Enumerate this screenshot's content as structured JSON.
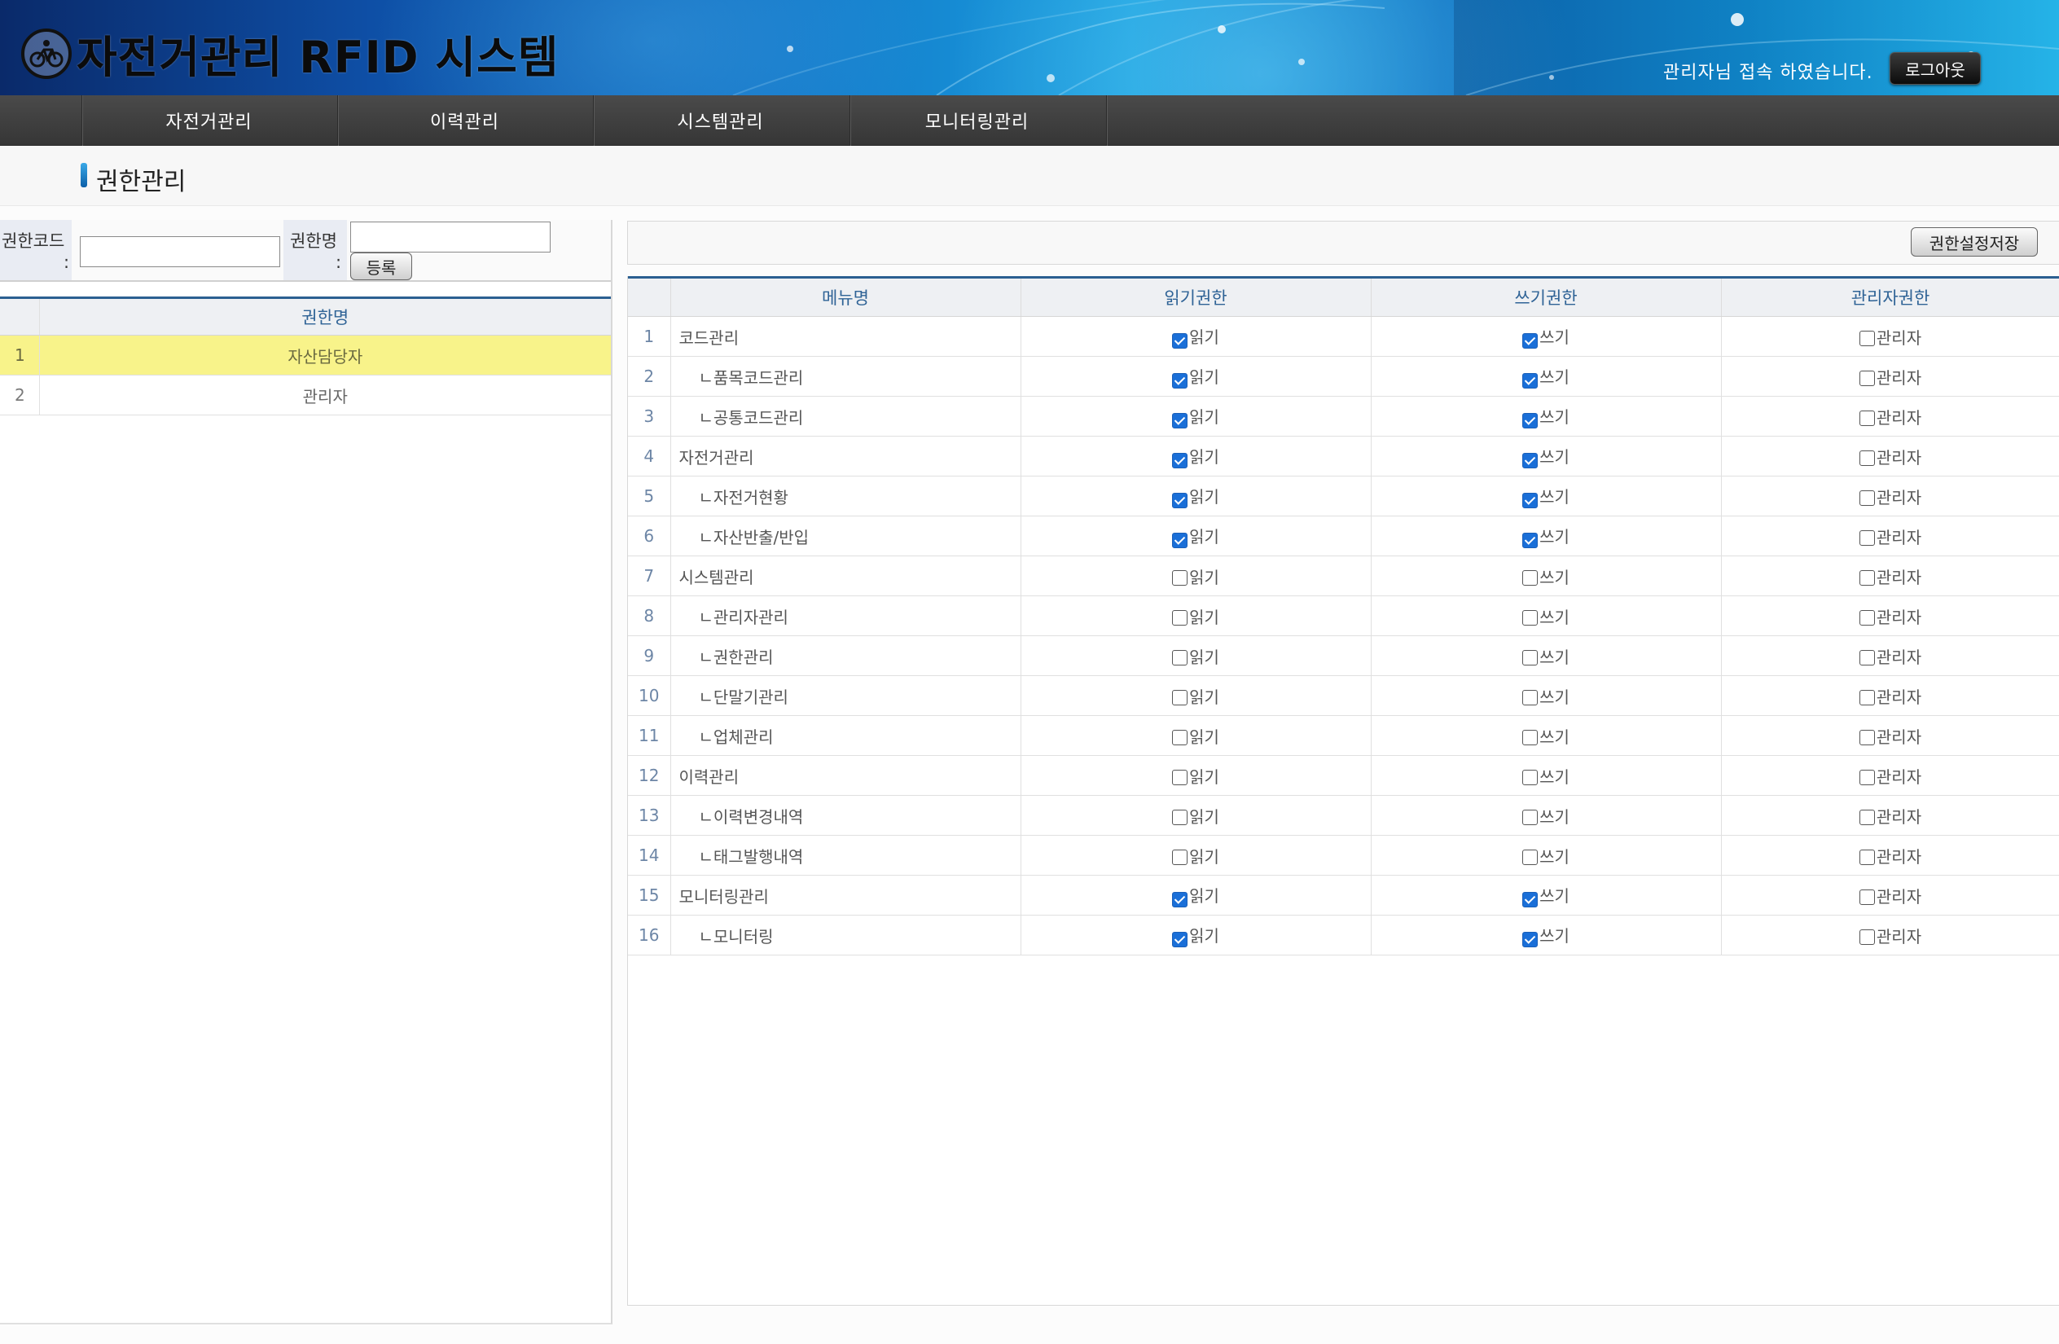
{
  "header": {
    "title": "자전거관리 RFID 시스템",
    "login_message": "관리자님 접속 하였습니다.",
    "logout_label": "로그아웃"
  },
  "nav": [
    {
      "label": "자전거관리"
    },
    {
      "label": "이력관리"
    },
    {
      "label": "시스템관리"
    },
    {
      "label": "모니터링관리"
    }
  ],
  "page": {
    "title": "권한관리"
  },
  "form": {
    "code_label_1": "권한코드",
    "code_label_2": ":",
    "name_label_1": "권한명",
    "name_label_2": ":",
    "code_value": "",
    "name_value": "",
    "register_label": "등록"
  },
  "roles": {
    "header_name": "권한명",
    "rows": [
      {
        "num": "1",
        "name": "자산담당자",
        "selected": true
      },
      {
        "num": "2",
        "name": "관리자",
        "selected": false
      }
    ]
  },
  "permissions": {
    "save_label": "권한설정저장",
    "headers": {
      "menu": "메뉴명",
      "read": "읽기권한",
      "write": "쓰기권한",
      "admin": "관리자권한"
    },
    "labels": {
      "read": "읽기",
      "write": "쓰기",
      "admin": "관리자"
    },
    "rows": [
      {
        "num": "1",
        "menu": "코드관리",
        "sub": false,
        "read": true,
        "write": true,
        "admin": false
      },
      {
        "num": "2",
        "menu": "ㄴ품목코드관리",
        "sub": true,
        "read": true,
        "write": true,
        "admin": false
      },
      {
        "num": "3",
        "menu": "ㄴ공통코드관리",
        "sub": true,
        "read": true,
        "write": true,
        "admin": false
      },
      {
        "num": "4",
        "menu": "자전거관리",
        "sub": false,
        "read": true,
        "write": true,
        "admin": false
      },
      {
        "num": "5",
        "menu": "ㄴ자전거현황",
        "sub": true,
        "read": true,
        "write": true,
        "admin": false
      },
      {
        "num": "6",
        "menu": "ㄴ자산반출/반입",
        "sub": true,
        "read": true,
        "write": true,
        "admin": false
      },
      {
        "num": "7",
        "menu": "시스템관리",
        "sub": false,
        "read": false,
        "write": false,
        "admin": false
      },
      {
        "num": "8",
        "menu": "ㄴ관리자관리",
        "sub": true,
        "read": false,
        "write": false,
        "admin": false
      },
      {
        "num": "9",
        "menu": "ㄴ권한관리",
        "sub": true,
        "read": false,
        "write": false,
        "admin": false
      },
      {
        "num": "10",
        "menu": "ㄴ단말기관리",
        "sub": true,
        "read": false,
        "write": false,
        "admin": false
      },
      {
        "num": "11",
        "menu": "ㄴ업체관리",
        "sub": true,
        "read": false,
        "write": false,
        "admin": false
      },
      {
        "num": "12",
        "menu": "이력관리",
        "sub": false,
        "read": false,
        "write": false,
        "admin": false
      },
      {
        "num": "13",
        "menu": "ㄴ이력변경내역",
        "sub": true,
        "read": false,
        "write": false,
        "admin": false
      },
      {
        "num": "14",
        "menu": "ㄴ태그발행내역",
        "sub": true,
        "read": false,
        "write": false,
        "admin": false
      },
      {
        "num": "15",
        "menu": "모니터링관리",
        "sub": false,
        "read": true,
        "write": true,
        "admin": false
      },
      {
        "num": "16",
        "menu": "ㄴ모니터링",
        "sub": true,
        "read": true,
        "write": true,
        "admin": false
      }
    ]
  },
  "colors": {
    "accent_blue": "#2b5f91",
    "selected_row": "#f8f38a",
    "nav_bg": "#3f3f3f",
    "checkbox_on": "#1a6fd8"
  }
}
